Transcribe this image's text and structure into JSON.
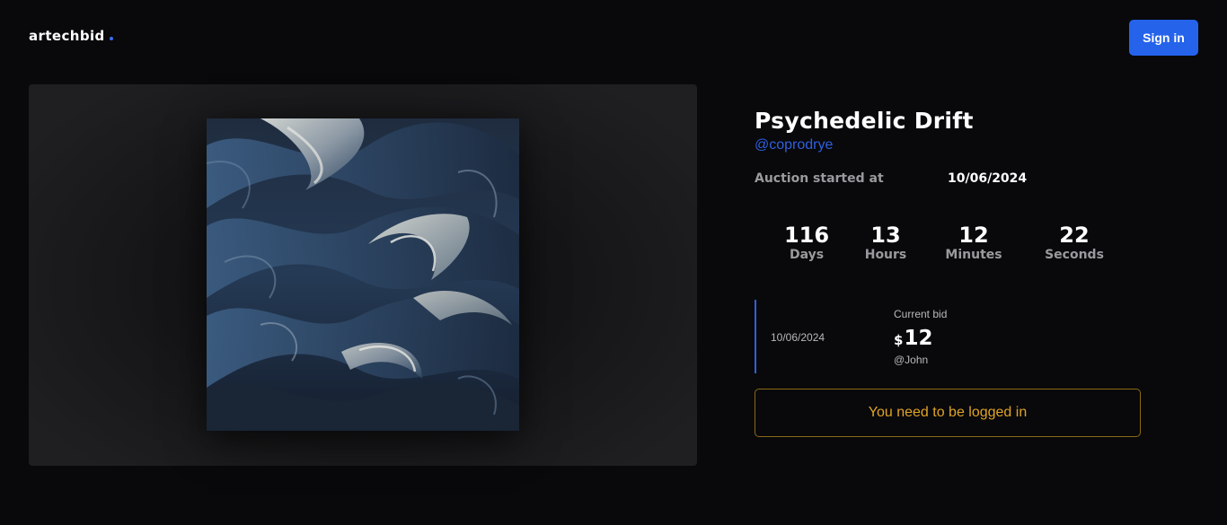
{
  "header": {
    "logo_text": "artechbid",
    "signin_label": "Sign in",
    "accent_color": "#2563eb"
  },
  "artwork": {
    "title": "Psychedelic Drift",
    "author": "@coprodrye",
    "auction_label": "Auction started at",
    "auction_date": "10/06/2024"
  },
  "countdown": [
    {
      "value": "116",
      "label": "Days"
    },
    {
      "value": "13",
      "label": "Hours"
    },
    {
      "value": "12",
      "label": "Minutes"
    },
    {
      "value": "22",
      "label": "Seconds"
    }
  ],
  "bid": {
    "date": "10/06/2024",
    "label": "Current bid",
    "currency": "$",
    "amount": "12",
    "user": "@John"
  },
  "notice": {
    "text": "You need to be logged in",
    "color": "#e0a325"
  }
}
